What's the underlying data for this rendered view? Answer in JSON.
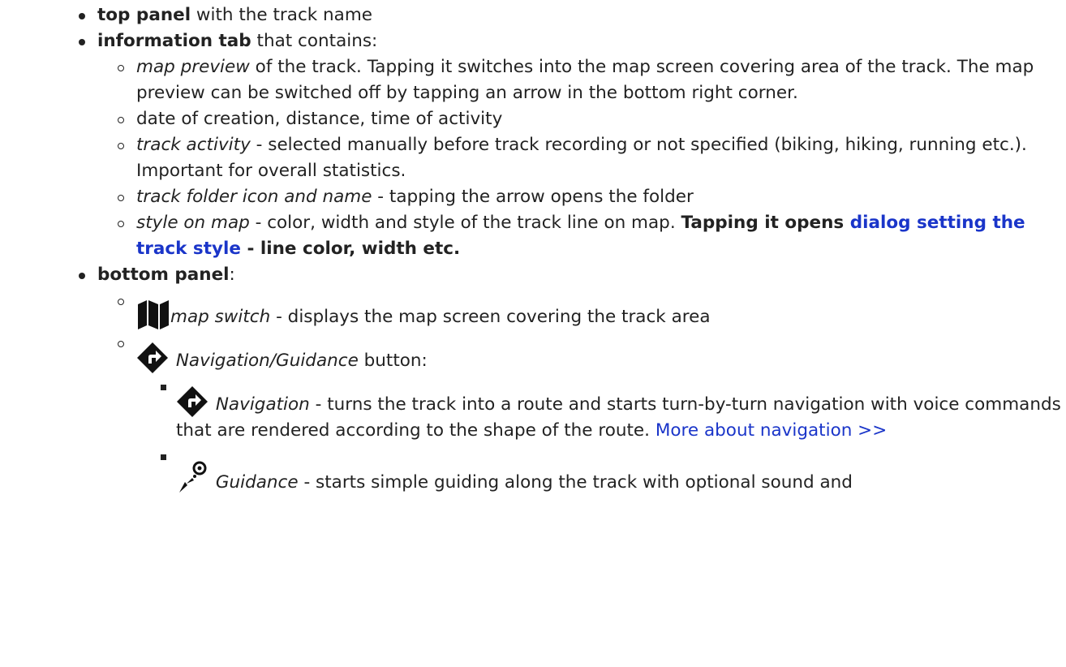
{
  "items": [
    {
      "title": "top panel",
      "rest": " with the track name"
    },
    {
      "title": "information tab",
      "rest": " that contains:",
      "sub": [
        {
          "em": "map preview",
          "text": " of the track. Tapping it switches into the map screen covering area of the track. The map preview can be switched off by tapping an arrow in the bottom right corner."
        },
        {
          "text": "date of creation, distance, time of activity"
        },
        {
          "em": "track activity",
          "text": " - selected manually before track recording or not specified (biking, hiking, running etc.). Important for overall statistics."
        },
        {
          "em": "track folder icon and name",
          "text": " - tapping the arrow opens the folder"
        },
        {
          "em": "style on map",
          "text": " - color, width and style of the track line on map. ",
          "bold_pre": "Tapping it opens ",
          "link": "dialog setting the track style",
          "bold_post": " - line color, width etc."
        }
      ]
    },
    {
      "title": "bottom panel",
      "rest": ":",
      "sub": [
        {
          "icon": "map-icon",
          "em": "map switch",
          "text": " - displays the map screen covering the track area"
        },
        {
          "icon": "navigation-icon",
          "em": "Navigation/Guidance",
          "text": " button:",
          "sub": [
            {
              "icon": "navigation-icon",
              "em": "Navigation",
              "text": " - turns the track into a route and starts turn-by-turn navigation with voice commands that are rendered according to the shape of the route. ",
              "link": "More about navigation >>"
            },
            {
              "icon": "guidance-icon",
              "em": "Guidance",
              "text": " - starts simple guiding along the track with optional sound and"
            }
          ]
        }
      ]
    }
  ]
}
